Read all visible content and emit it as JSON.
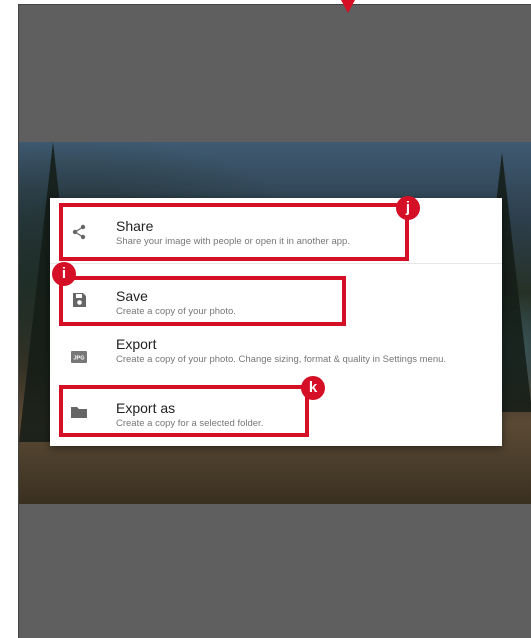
{
  "menu": {
    "share": {
      "title": "Share",
      "description": "Share your image with people or open it in another app."
    },
    "save": {
      "title": "Save",
      "description": "Create a copy of your photo."
    },
    "export": {
      "title": "Export",
      "description": "Create a copy of your photo. Change sizing, format & quality in Settings menu."
    },
    "export_as": {
      "title": "Export as",
      "description": "Create a copy for a selected folder."
    }
  },
  "icons": {
    "share": "share-icon",
    "save": "save-icon",
    "export": "jpg-file-icon",
    "export_as": "folder-icon",
    "export_badge_text": "JPG"
  },
  "callouts": {
    "j": "j",
    "i": "i",
    "k": "k"
  },
  "colors": {
    "highlight": "#d50f25",
    "overlay": "#5f5f5f",
    "menu_bg": "#ffffff"
  }
}
